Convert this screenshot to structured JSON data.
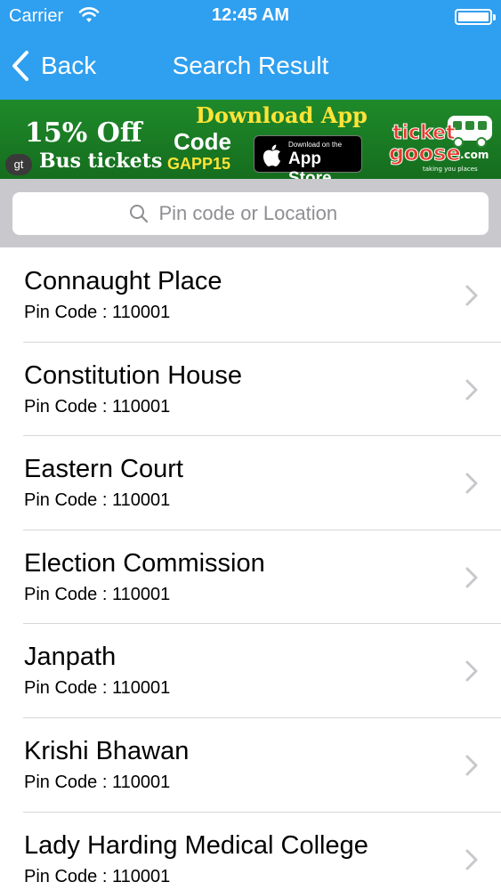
{
  "status_bar": {
    "carrier": "Carrier",
    "time": "12:45 AM"
  },
  "nav": {
    "back_label": "Back",
    "title": "Search Result"
  },
  "banner": {
    "offer": "15% Off",
    "subtitle": "Bus tickets",
    "badge": "gt",
    "headline": "Download App",
    "code_label": "Code",
    "code_value": "GAPP15",
    "store_small": "Download on the",
    "store_big": "App Store",
    "logo_text_1": "ticket",
    "logo_text_2": "goose",
    "logo_text_3": ".com",
    "logo_tagline": "taking you places"
  },
  "search": {
    "placeholder": "Pin code or Location"
  },
  "results": [
    {
      "name": "Connaught Place",
      "pin": "Pin Code : 110001"
    },
    {
      "name": "Constitution House",
      "pin": "Pin Code : 110001"
    },
    {
      "name": "Eastern Court",
      "pin": "Pin Code : 110001"
    },
    {
      "name": "Election Commission",
      "pin": "Pin Code : 110001"
    },
    {
      "name": "Janpath",
      "pin": "Pin Code : 110001"
    },
    {
      "name": "Krishi Bhawan",
      "pin": "Pin Code : 110001"
    },
    {
      "name": "Lady Harding Medical College",
      "pin": "Pin Code : 110001"
    }
  ],
  "colors": {
    "nav_blue": "#2f9ff0",
    "banner_green": "#1f8a2a",
    "banner_yellow": "#ffe437",
    "search_bg": "#c9c9cd"
  }
}
